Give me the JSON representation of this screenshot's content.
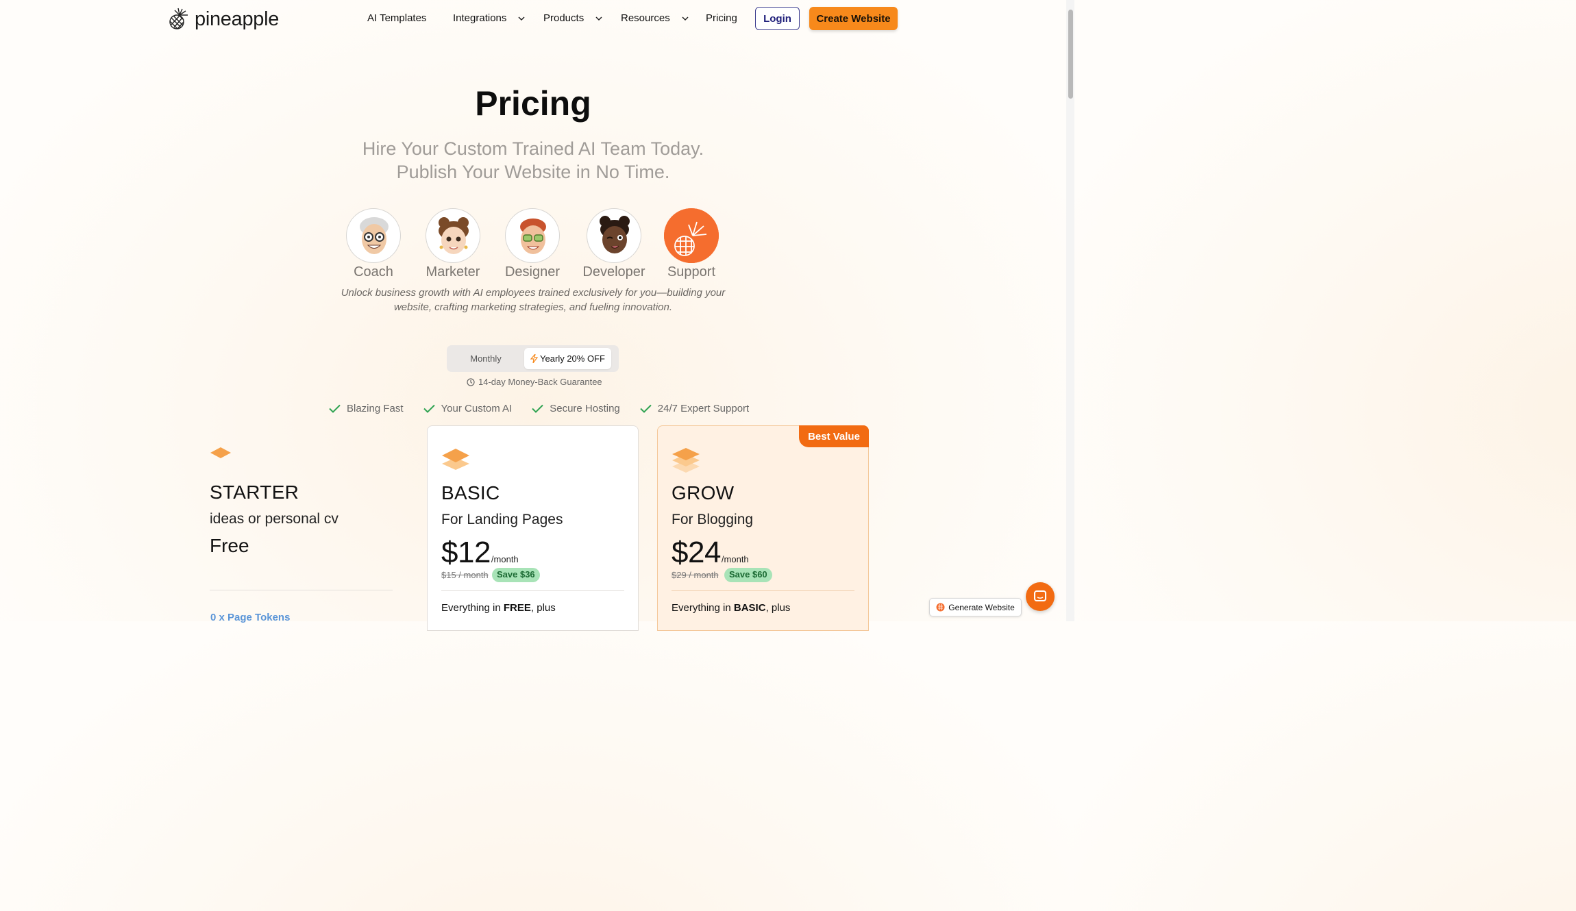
{
  "nav": {
    "logo": "pineapple",
    "items": [
      {
        "label": "AI Templates"
      },
      {
        "label": "Integrations"
      },
      {
        "label": "Products"
      },
      {
        "label": "Resources"
      },
      {
        "label": "Pricing"
      }
    ],
    "login": "Login",
    "create": "Create Website"
  },
  "hero": {
    "title": "Pricing",
    "subtitle_line1": "Hire Your Custom Trained AI Team Today.",
    "subtitle_line2": "Publish Your Website in No Time.",
    "team": [
      "Coach",
      "Marketer",
      "Designer",
      "Developer",
      "Support"
    ],
    "desc_line1": "Unlock business growth with AI employees trained exclusively for you—building your",
    "desc_line2": "website, crafting marketing strategies, and fueling innovation."
  },
  "billing": {
    "monthly": "Monthly",
    "yearly": "Yearly 20% OFF",
    "guarantee": "14-day Money-Back Guarantee"
  },
  "features": [
    "Blazing Fast",
    "Your Custom AI",
    "Secure Hosting",
    "24/7 Expert Support"
  ],
  "plans": {
    "starter": {
      "name": "STARTER",
      "desc": "ideas or personal cv",
      "price": "Free",
      "tokens": "0 x Page Tokens"
    },
    "basic": {
      "name": "BASIC",
      "desc": "For Landing Pages",
      "price": "$12",
      "per": "/month",
      "old": "$15 / month",
      "save": "Save $36",
      "inc_prefix": "Everything in ",
      "inc_plan": "FREE",
      "inc_suffix": ", plus"
    },
    "grow": {
      "badge": "Best Value",
      "name": "GROW",
      "desc": "For Blogging",
      "price": "$24",
      "per": "/month",
      "old": "$29 / month",
      "save": "Save $60",
      "inc_prefix": "Everything in ",
      "inc_plan": "BASIC",
      "inc_suffix": ", plus"
    }
  },
  "widgets": {
    "generate": "Generate Website"
  },
  "colors": {
    "accent": "#f7891b",
    "badge": "#f26b12",
    "save_bg": "#a8e3b7"
  }
}
